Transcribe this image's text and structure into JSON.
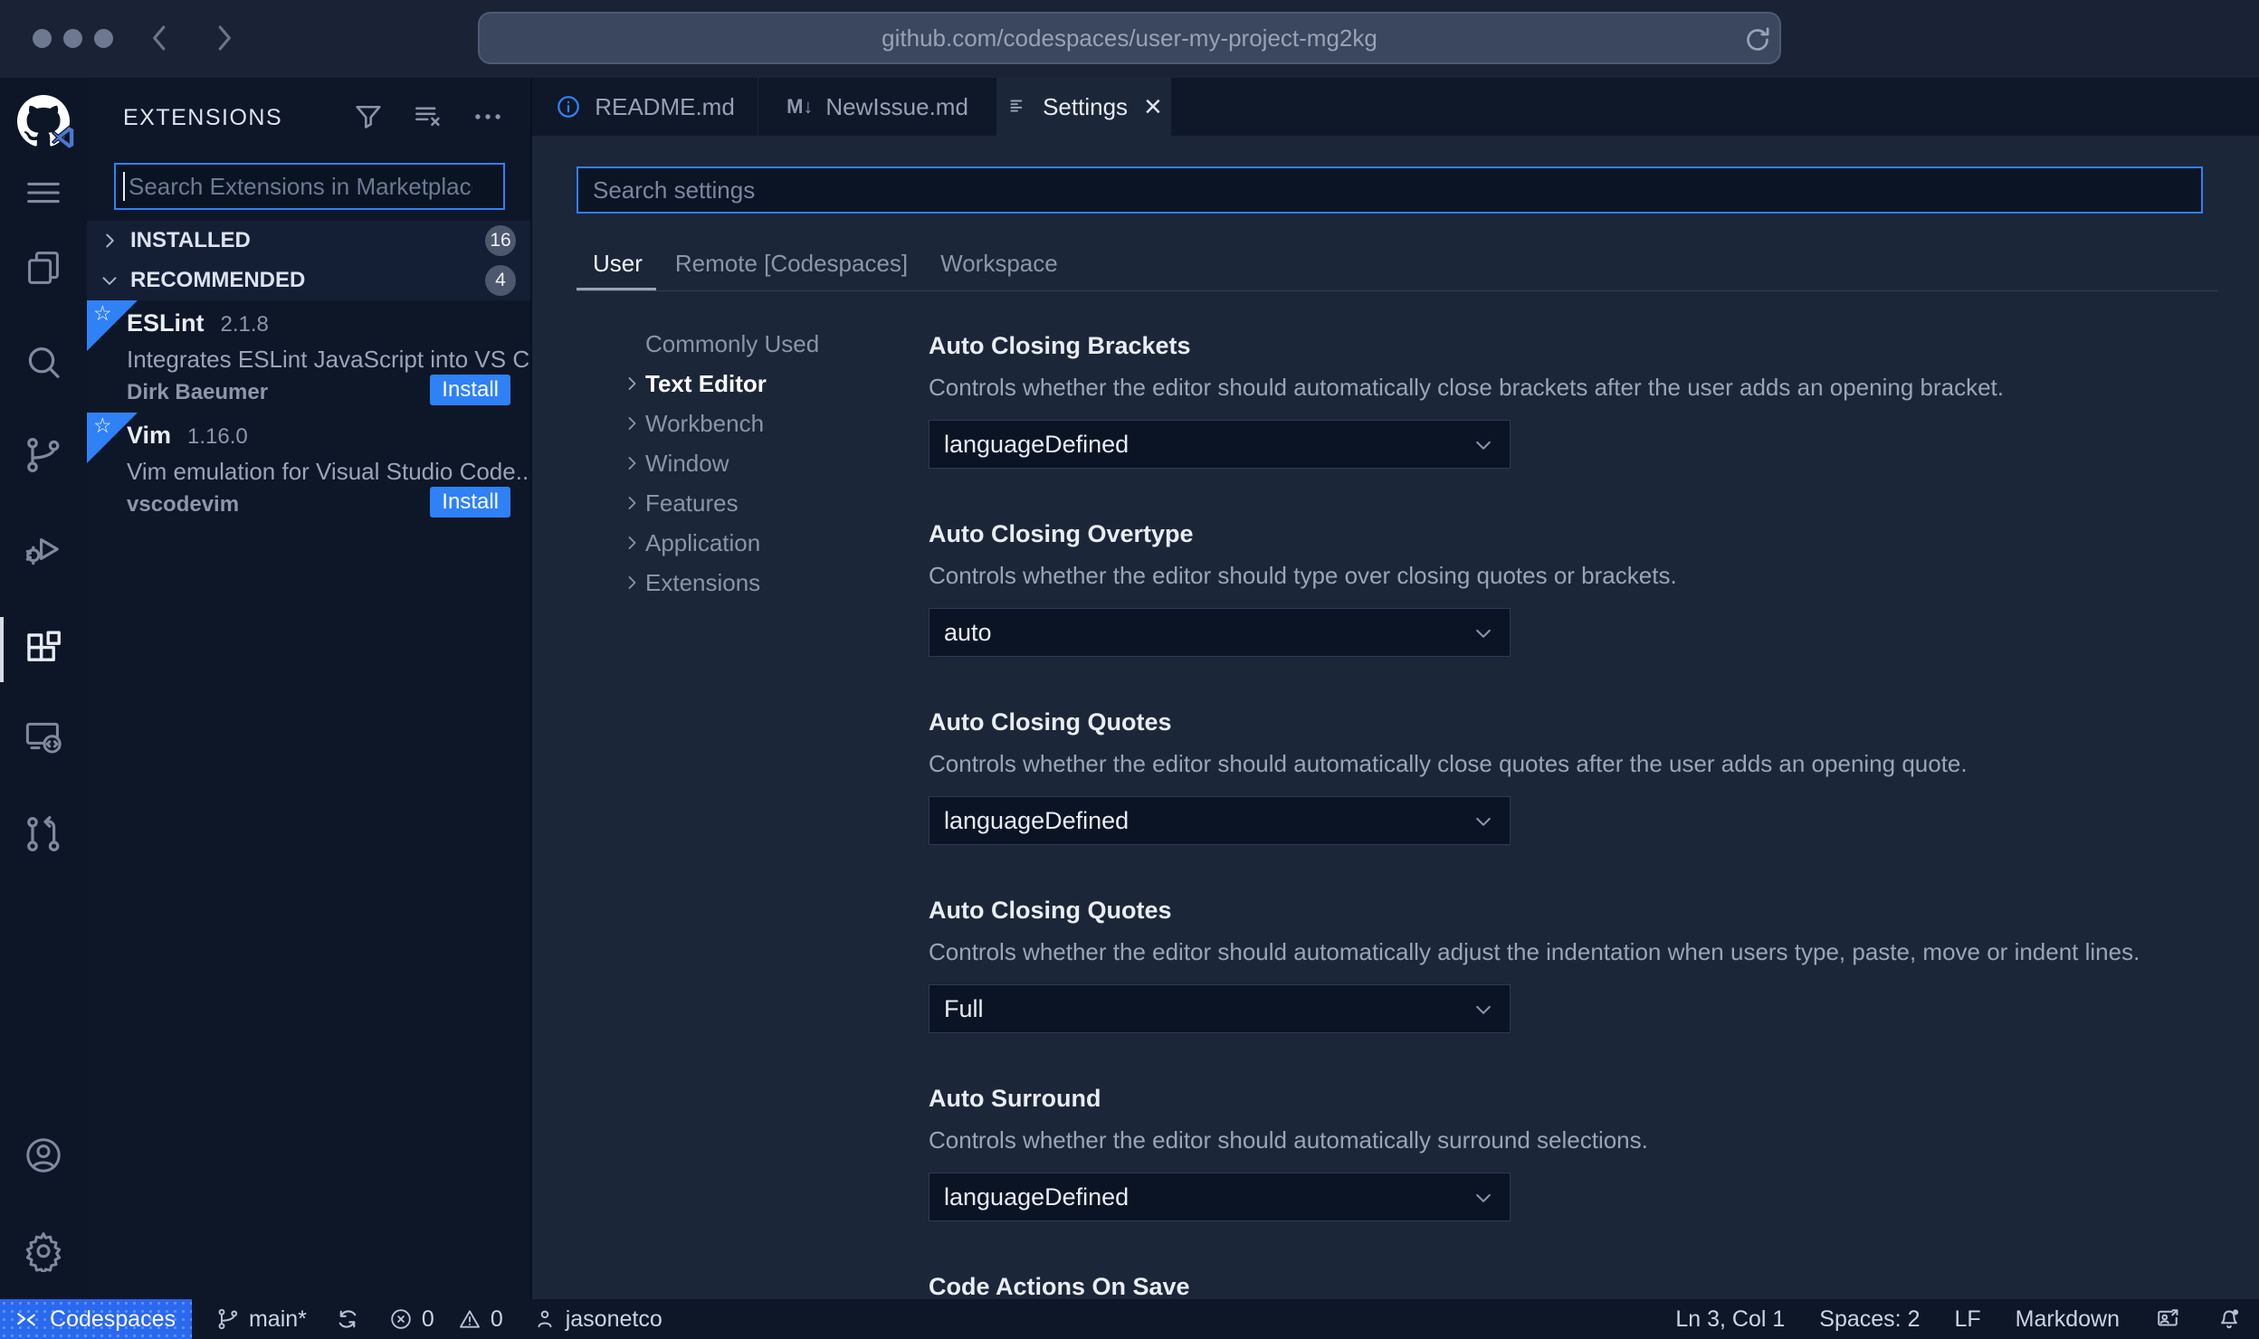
{
  "browser": {
    "url": "github.com/codespaces/user-my-project-mg2kg"
  },
  "colors": {
    "accent": "#2f81f7",
    "status_chip": "#2968f0",
    "install_button": "#2f81f7"
  },
  "icons": {
    "markdown": "M↓",
    "close": "×",
    "star": "☆"
  },
  "sidebar": {
    "title": "EXTENSIONS",
    "search_placeholder": "Search Extensions in Marketplace",
    "sections": [
      {
        "label": "INSTALLED",
        "count": "16"
      },
      {
        "label": "RECOMMENDED",
        "count": "4"
      }
    ],
    "extensions": [
      {
        "name": "ESLint",
        "version": "2.1.8",
        "description": "Integrates ESLint JavaScript into VS C...",
        "publisher": "Dirk Baeumer",
        "action": "Install"
      },
      {
        "name": "Vim",
        "version": "1.16.0",
        "description": "Vim emulation for Visual Studio Code...",
        "publisher": "vscodevim",
        "action": "Install"
      }
    ]
  },
  "tabs": [
    {
      "label": "README.md"
    },
    {
      "label": "NewIssue.md"
    },
    {
      "label": "Settings"
    }
  ],
  "settings": {
    "search_placeholder": "Search settings",
    "scopes": [
      "User",
      "Remote [Codespaces]",
      "Workspace"
    ],
    "toc": [
      "Commonly Used",
      "Text Editor",
      "Workbench",
      "Window",
      "Features",
      "Application",
      "Extensions"
    ],
    "items": [
      {
        "title": "Auto Closing Brackets",
        "description": "Controls whether the editor should automatically close brackets after the user adds an opening bracket.",
        "value": "languageDefined"
      },
      {
        "title": "Auto Closing Overtype",
        "description": "Controls whether the editor should type over closing quotes or brackets.",
        "value": "auto"
      },
      {
        "title": "Auto Closing Quotes",
        "description": "Controls whether the editor should automatically close quotes after the user adds an opening quote.",
        "value": "languageDefined"
      },
      {
        "title": "Auto Closing Quotes",
        "description": "Controls whether the editor should automatically adjust the indentation when users type, paste, move or indent lines.",
        "value": "Full"
      },
      {
        "title": "Auto Surround",
        "description": "Controls whether the editor should automatically surround selections.",
        "value": "languageDefined"
      },
      {
        "title": "Code Actions On Save",
        "description": "",
        "value": ""
      }
    ]
  },
  "status_bar": {
    "codespaces": "Codespaces",
    "branch": "main*",
    "errors": "0",
    "warnings": "0",
    "user": "jasonetco",
    "line_col": "Ln 3, Col 1",
    "indent": "Spaces: 2",
    "eol": "LF",
    "language": "Markdown"
  }
}
